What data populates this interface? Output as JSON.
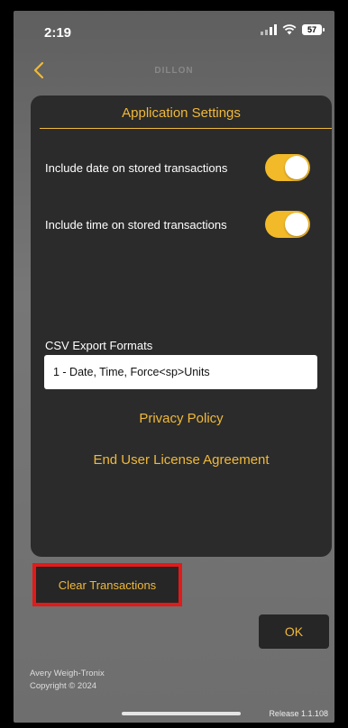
{
  "status_bar": {
    "time": "2:19",
    "battery": "57"
  },
  "header": {
    "logo_text": "DILLON"
  },
  "settings": {
    "title": "Application Settings",
    "include_date_label": "Include date on stored transactions",
    "include_date_on": true,
    "include_time_label": "Include time on stored transactions",
    "include_time_on": true,
    "csv_label": "CSV Export Formats",
    "csv_value": "1 - Date, Time, Force<sp>Units",
    "privacy_policy": "Privacy Policy",
    "eula": "End User License Agreement"
  },
  "actions": {
    "clear_transactions": "Clear Transactions",
    "ok": "OK"
  },
  "footer": {
    "company": "Avery Weigh-Tronix",
    "copyright": "Copyright © 2024",
    "release": "Release 1.1.108"
  },
  "colors": {
    "accent": "#f0b93a",
    "toggle_on": "#f2b928",
    "panel": "#2b2b2b",
    "highlight": "#e21a1a"
  }
}
